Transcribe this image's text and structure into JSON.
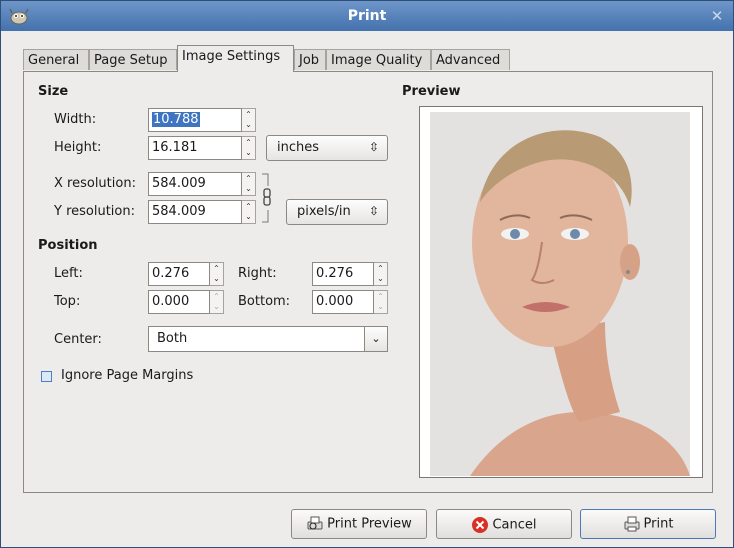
{
  "window": {
    "title": "Print"
  },
  "tabs": [
    {
      "label": "General"
    },
    {
      "label": "Page Setup"
    },
    {
      "label": "Image Settings"
    },
    {
      "label": "Job"
    },
    {
      "label": "Image Quality"
    },
    {
      "label": "Advanced"
    }
  ],
  "active_tab": "Image Settings",
  "size": {
    "title": "Size",
    "width_label": "Width:",
    "width_value": "10.788",
    "height_label": "Height:",
    "height_value": "16.181",
    "unit": "inches",
    "xres_label": "X resolution:",
    "xres_value": "584.009",
    "yres_label": "Y resolution:",
    "yres_value": "584.009",
    "res_unit": "pixels/in"
  },
  "position": {
    "title": "Position",
    "left_label": "Left:",
    "left_value": "0.276",
    "right_label": "Right:",
    "right_value": "0.276",
    "top_label": "Top:",
    "top_value": "0.000",
    "bottom_label": "Bottom:",
    "bottom_value": "0.000",
    "center_label": "Center:",
    "center_value": "Both"
  },
  "ignore_margins_label": "Ignore Page Margins",
  "preview": {
    "title": "Preview"
  },
  "buttons": {
    "print_preview": "Print Preview",
    "cancel": "Cancel",
    "print": "Print"
  },
  "colors": {
    "titlebar": "#4472ad",
    "selection": "#3f75c0",
    "cancel_icon": "#d93025"
  }
}
